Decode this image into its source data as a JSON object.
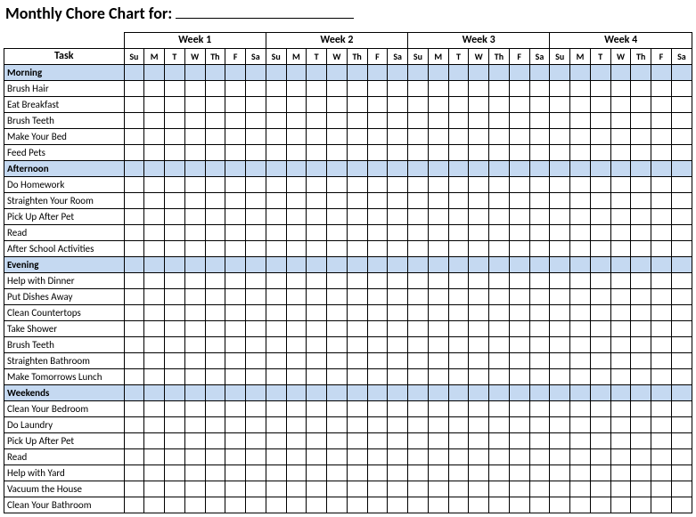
{
  "title": "Monthly Chore Chart for:",
  "task_header": "Task",
  "weeks": [
    "Week 1",
    "Week 2",
    "Week 3",
    "Week 4"
  ],
  "days": [
    "Su",
    "M",
    "T",
    "W",
    "Th",
    "F",
    "Sa"
  ],
  "sections": [
    {
      "name": "Morning",
      "tasks": [
        "Brush Hair",
        "Eat Breakfast",
        "Brush Teeth",
        "Make Your Bed",
        "Feed Pets"
      ]
    },
    {
      "name": "Afternoon",
      "tasks": [
        "Do Homework",
        "Straighten Your Room",
        "Pick Up After Pet",
        "Read",
        "After School Activities"
      ]
    },
    {
      "name": "Evening",
      "tasks": [
        "Help with Dinner",
        "Put Dishes Away",
        "Clean Countertops",
        "Take Shower",
        "Brush Teeth",
        "Straighten Bathroom",
        "Make Tomorrows Lunch"
      ]
    },
    {
      "name": "Weekends",
      "tasks": [
        "Clean Your Bedroom",
        "Do Laundry",
        "Pick Up After Pet",
        "Read",
        "Help with Yard",
        "Vacuum the House",
        "Clean Your Bathroom"
      ]
    }
  ]
}
